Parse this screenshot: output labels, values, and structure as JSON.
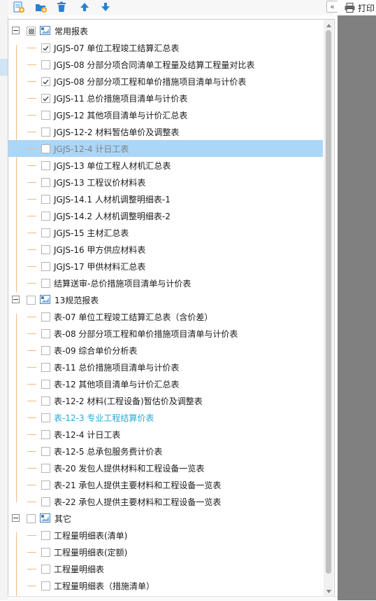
{
  "toolbar": {
    "buttons": [
      "add-report-icon",
      "add-folder-icon",
      "delete-icon",
      "move-up-icon",
      "move-down-icon"
    ],
    "collapse_label": "«"
  },
  "print": {
    "label": "打印"
  },
  "tree": [
    {
      "kind": "group",
      "label": "常用报表",
      "check": "partial",
      "expanded": true
    },
    {
      "kind": "child",
      "label": "JGJS-07 单位工程竣工结算汇总表",
      "checked": true
    },
    {
      "kind": "child",
      "label": "JGJS-08 分部分项合同清单工程量及结算工程量对比表",
      "checked": false
    },
    {
      "kind": "child",
      "label": "JGJS-08 分部分项工程和单价措施项目清单与计价表",
      "checked": true
    },
    {
      "kind": "child",
      "label": "JGJS-11 总价措施项目清单与计价表",
      "checked": true
    },
    {
      "kind": "child",
      "label": "JGJS-12 其他项目清单与计价汇总表",
      "checked": false
    },
    {
      "kind": "child",
      "label": "JGJS-12-2 材料暂估单价及调整表",
      "checked": false
    },
    {
      "kind": "child",
      "label": "JGJS-12-4 计日工表",
      "checked": false,
      "selected": true,
      "style": "dim"
    },
    {
      "kind": "child",
      "label": "JGJS-13 单位工程人材机汇总表",
      "checked": false
    },
    {
      "kind": "child",
      "label": "JGJS-13 工程议价材料表",
      "checked": false
    },
    {
      "kind": "child",
      "label": "JGJS-14.1 人材机调整明细表-1",
      "checked": false
    },
    {
      "kind": "child",
      "label": "JGJS-14.2 人材机调整明细表-2",
      "checked": false
    },
    {
      "kind": "child",
      "label": "JGJS-15 主材汇总表",
      "checked": false
    },
    {
      "kind": "child",
      "label": "JGJS-16 甲方供应材料表",
      "checked": false
    },
    {
      "kind": "child",
      "label": "JGJS-17 甲供材料汇总表",
      "checked": false
    },
    {
      "kind": "child",
      "label": "结算送审-总价措施项目清单与计价表",
      "checked": false
    },
    {
      "kind": "group",
      "label": "13规范报表",
      "check": "none",
      "expanded": true
    },
    {
      "kind": "child",
      "label": "表-07 单位工程竣工结算汇总表（含价差）",
      "checked": false
    },
    {
      "kind": "child",
      "label": "表-08 分部分项工程和单价措施项目清单与计价表",
      "checked": false
    },
    {
      "kind": "child",
      "label": "表-09 综合单价分析表",
      "checked": false
    },
    {
      "kind": "child",
      "label": "表-11 总价措施项目清单与计价表",
      "checked": false
    },
    {
      "kind": "child",
      "label": "表-12 其他项目清单与计价汇总表",
      "checked": false
    },
    {
      "kind": "child",
      "label": "表-12-2 材料(工程设备)暂估价及调整表",
      "checked": false
    },
    {
      "kind": "child",
      "label": "表-12-3 专业工程结算价表",
      "checked": false,
      "style": "link"
    },
    {
      "kind": "child",
      "label": "表-12-4 计日工表",
      "checked": false
    },
    {
      "kind": "child",
      "label": "表-12-5 总承包服务费计价表",
      "checked": false
    },
    {
      "kind": "child",
      "label": "表-20 发包人提供材料和工程设备一览表",
      "checked": false
    },
    {
      "kind": "child",
      "label": "表-21 承包人提供主要材料和工程设备一览表",
      "checked": false
    },
    {
      "kind": "child",
      "label": "表-22 承包人提供主要材料和工程设备一览表",
      "checked": false
    },
    {
      "kind": "group",
      "label": "其它",
      "check": "none",
      "expanded": true
    },
    {
      "kind": "child",
      "label": "工程量明细表(清单)",
      "checked": false
    },
    {
      "kind": "child",
      "label": "工程量明细表(定额)",
      "checked": false
    },
    {
      "kind": "child",
      "label": "工程量明细表",
      "checked": false
    },
    {
      "kind": "child",
      "label": "工程量明细表（措施清单）",
      "checked": false
    }
  ],
  "colors": {
    "selection": "#aad6f8",
    "tree_line": "#f5b87a",
    "link_text": "#2ba9d9",
    "toolbar_icon": "#2a7fd4",
    "preview_bg": "#808080"
  }
}
